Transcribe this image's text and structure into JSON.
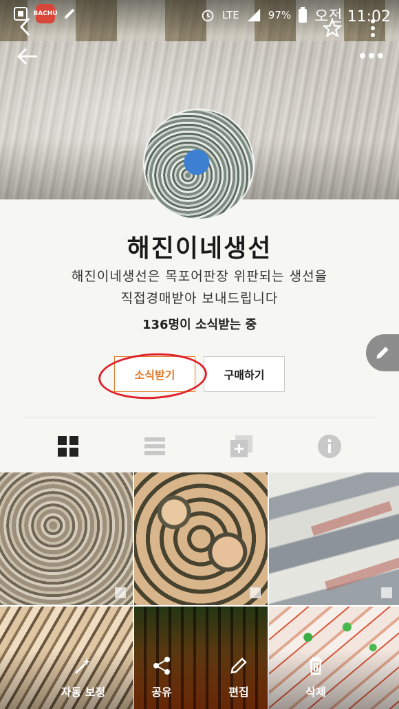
{
  "status_bar": {
    "app_badge": "BACHU",
    "network": "LTE",
    "battery": "97%",
    "time": "오전 11:02"
  },
  "store": {
    "name": "해진이네생선",
    "description_line1": "해진이네생선은 목포어판장 위판되는 생선을",
    "description_line2": "직접경매받아 보내드립니다",
    "subscribers": "136명이 소식받는 중"
  },
  "buttons": {
    "subscribe": "소식받기",
    "buy": "구매하기"
  },
  "actions": {
    "auto_correct": "자동 보정",
    "share": "공유",
    "edit": "편집",
    "delete": "삭제"
  },
  "icons": {
    "back_top": "chevron-left-icon",
    "back": "arrow-left-icon",
    "star": "star-icon",
    "more_vert": "more-vertical-icon",
    "more_horiz": "more-horizontal-icon",
    "grid": "grid-icon",
    "list": "list-icon",
    "add_album": "add-album-icon",
    "info": "info-icon",
    "edit_pen": "pencil-icon"
  },
  "colors": {
    "accent": "#e07a2b",
    "annotation": "#e0202a"
  }
}
